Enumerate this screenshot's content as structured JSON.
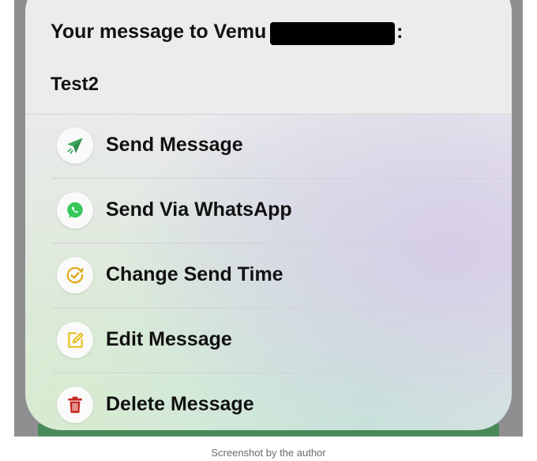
{
  "dialog": {
    "title": "Your message to Vemu",
    "title_suffix": ":",
    "message": "Test2"
  },
  "actions": [
    {
      "label": "Send Message",
      "icon": "send-icon",
      "color": "#3aa85a"
    },
    {
      "label": "Send Via WhatsApp",
      "icon": "whatsapp-icon",
      "color": "#34c759"
    },
    {
      "label": "Change Send Time",
      "icon": "clock-check-icon",
      "color": "#e0a416"
    },
    {
      "label": "Edit Message",
      "icon": "edit-icon",
      "color": "#e6c21a"
    },
    {
      "label": "Delete Message",
      "icon": "trash-icon",
      "color": "#c6281f"
    }
  ],
  "caption": "Screenshot by the author"
}
